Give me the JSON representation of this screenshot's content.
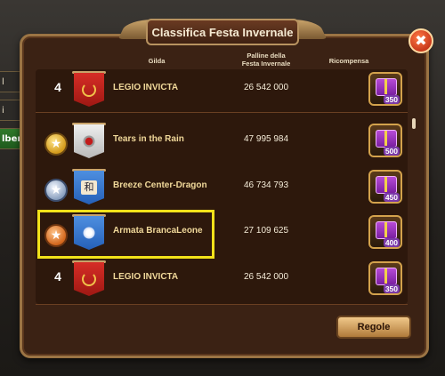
{
  "window": {
    "title": "Classifica Festa Invernale",
    "close_label": "✖"
  },
  "side_tabs": [
    {
      "label": "l"
    },
    {
      "label": "i"
    },
    {
      "label": "lbero"
    }
  ],
  "columns": {
    "gilda": "Gilda",
    "palline_line1": "Palline della",
    "palline_line2": "Festa Invernale",
    "ricompensa": "Ricompensa"
  },
  "rows": [
    {
      "rank": "4",
      "medal": "none",
      "banner": "red",
      "emblem": "laurel",
      "guild": "LEGIO INVICTA",
      "balls": "26 542 000",
      "reward": "350"
    },
    {
      "rank": "1",
      "medal": "gold",
      "banner": "white",
      "emblem": "flower",
      "guild": "Tears in the Rain",
      "balls": "47 995 984",
      "reward": "500"
    },
    {
      "rank": "2",
      "medal": "silver",
      "banner": "blue",
      "emblem": "kanji",
      "emblem_text": "和",
      "guild": "Breeze Center-Dragon",
      "balls": "46 734 793",
      "reward": "450"
    },
    {
      "rank": "3",
      "medal": "bronze",
      "banner": "blue",
      "emblem": "snow",
      "guild": "Armata BrancaLeone",
      "balls": "27 109 625",
      "reward": "400"
    },
    {
      "rank": "4",
      "medal": "none",
      "banner": "red",
      "emblem": "laurel",
      "guild": "LEGIO INVICTA",
      "balls": "26 542 000",
      "reward": "350"
    }
  ],
  "buttons": {
    "rules": "Regole"
  },
  "colors": {
    "highlight": "#f2e21a",
    "guild_name": "#f0d89a",
    "panel_border": "#9b7444"
  }
}
